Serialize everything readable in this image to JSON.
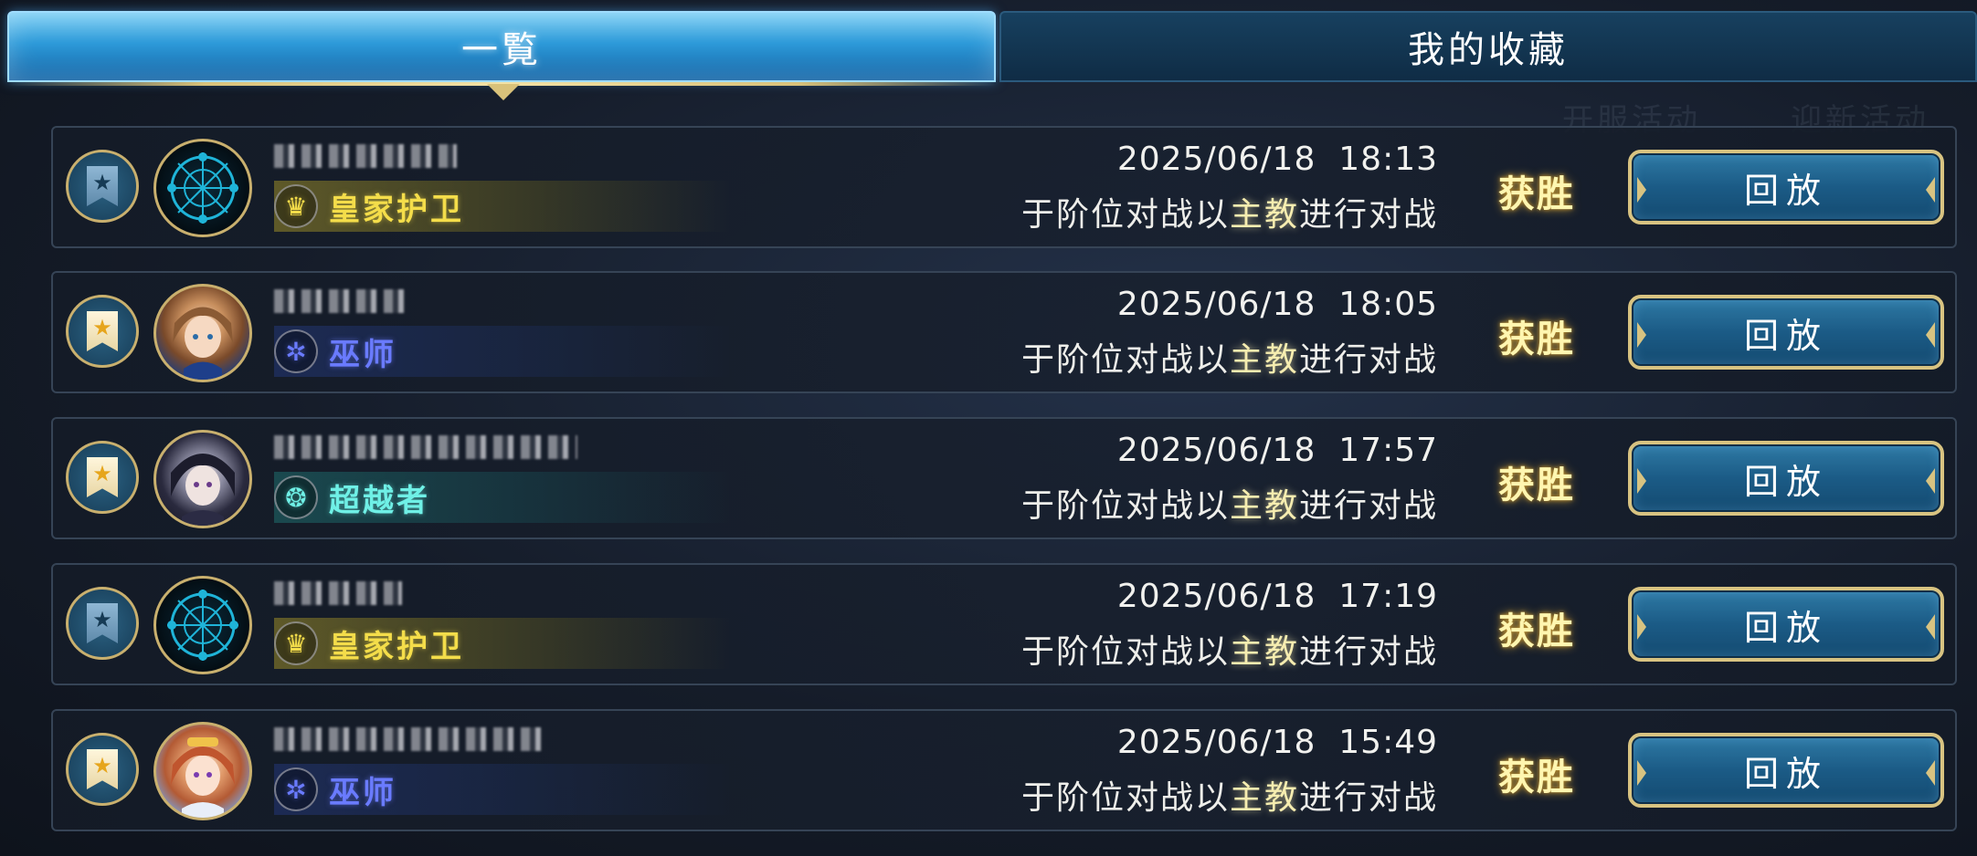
{
  "tabs": {
    "all_label": "一覧",
    "favorites_label": "我的收藏"
  },
  "replays": [
    {
      "favorited": false,
      "avatar": "rune-circle-emblem",
      "player_name": "▇▇▆▅ ▖▗ ▘",
      "class_icon": "crown-icon",
      "class_name": "皇家护卫",
      "class_key": "royal",
      "timestamp": "2025/06/18  18:13",
      "desc_pre": "于阶位对战以",
      "desc_highlight": "主教",
      "desc_post": "进行对战",
      "result": "获胜",
      "replay_label": "回放"
    },
    {
      "favorited": true,
      "avatar": "brown-haired-girl-portrait",
      "player_name": "▄▅▆ ▇▆▅",
      "class_icon": "rune-icon",
      "class_name": "巫师",
      "class_key": "witch",
      "timestamp": "2025/06/18  18:05",
      "desc_pre": "于阶位对战以",
      "desc_highlight": "主教",
      "desc_post": "进行对战",
      "result": "获胜",
      "replay_label": "回放"
    },
    {
      "favorited": true,
      "avatar": "dark-haired-boy-portrait",
      "player_name": "▆▅ ▄▆ ▅▇ ▆▅ ▇▆▅ ▗▖",
      "class_icon": "spiral-icon",
      "class_name": "超越者",
      "class_key": "trans",
      "timestamp": "2025/06/18  17:57",
      "desc_pre": "于阶位对战以",
      "desc_highlight": "主教",
      "desc_post": "进行对战",
      "result": "获胜",
      "replay_label": "回放"
    },
    {
      "favorited": false,
      "avatar": "rune-circle-emblem",
      "player_name": "▆ ▅▆▇ ▖",
      "class_icon": "crown-icon",
      "class_name": "皇家护卫",
      "class_key": "royal",
      "timestamp": "2025/06/18  17:19",
      "desc_pre": "于阶位对战以",
      "desc_highlight": "主教",
      "desc_post": "进行对战",
      "result": "获胜",
      "replay_label": "回放"
    },
    {
      "favorited": true,
      "avatar": "red-haired-girl-portrait",
      "player_name": "▆▅ ▇ ▆▅ ▄ ▇▆ ▅▆▇▆▅",
      "class_icon": "rune-icon",
      "class_name": "巫师",
      "class_key": "witch",
      "timestamp": "2025/06/18  15:49",
      "desc_pre": "于阶位对战以",
      "desc_highlight": "主教",
      "desc_post": "进行对战",
      "result": "获胜",
      "replay_label": "回放"
    }
  ],
  "background_hints": [
    "开服活动",
    "迎新活动"
  ],
  "colors": {
    "accent_gold": "#d8c381",
    "tab_active_blue": "#2d9ad9",
    "royal_yellow": "#f4dd4a",
    "witch_blue": "#6a7bff",
    "trans_teal": "#6ff0e6",
    "win_text": "#fff6b0"
  }
}
